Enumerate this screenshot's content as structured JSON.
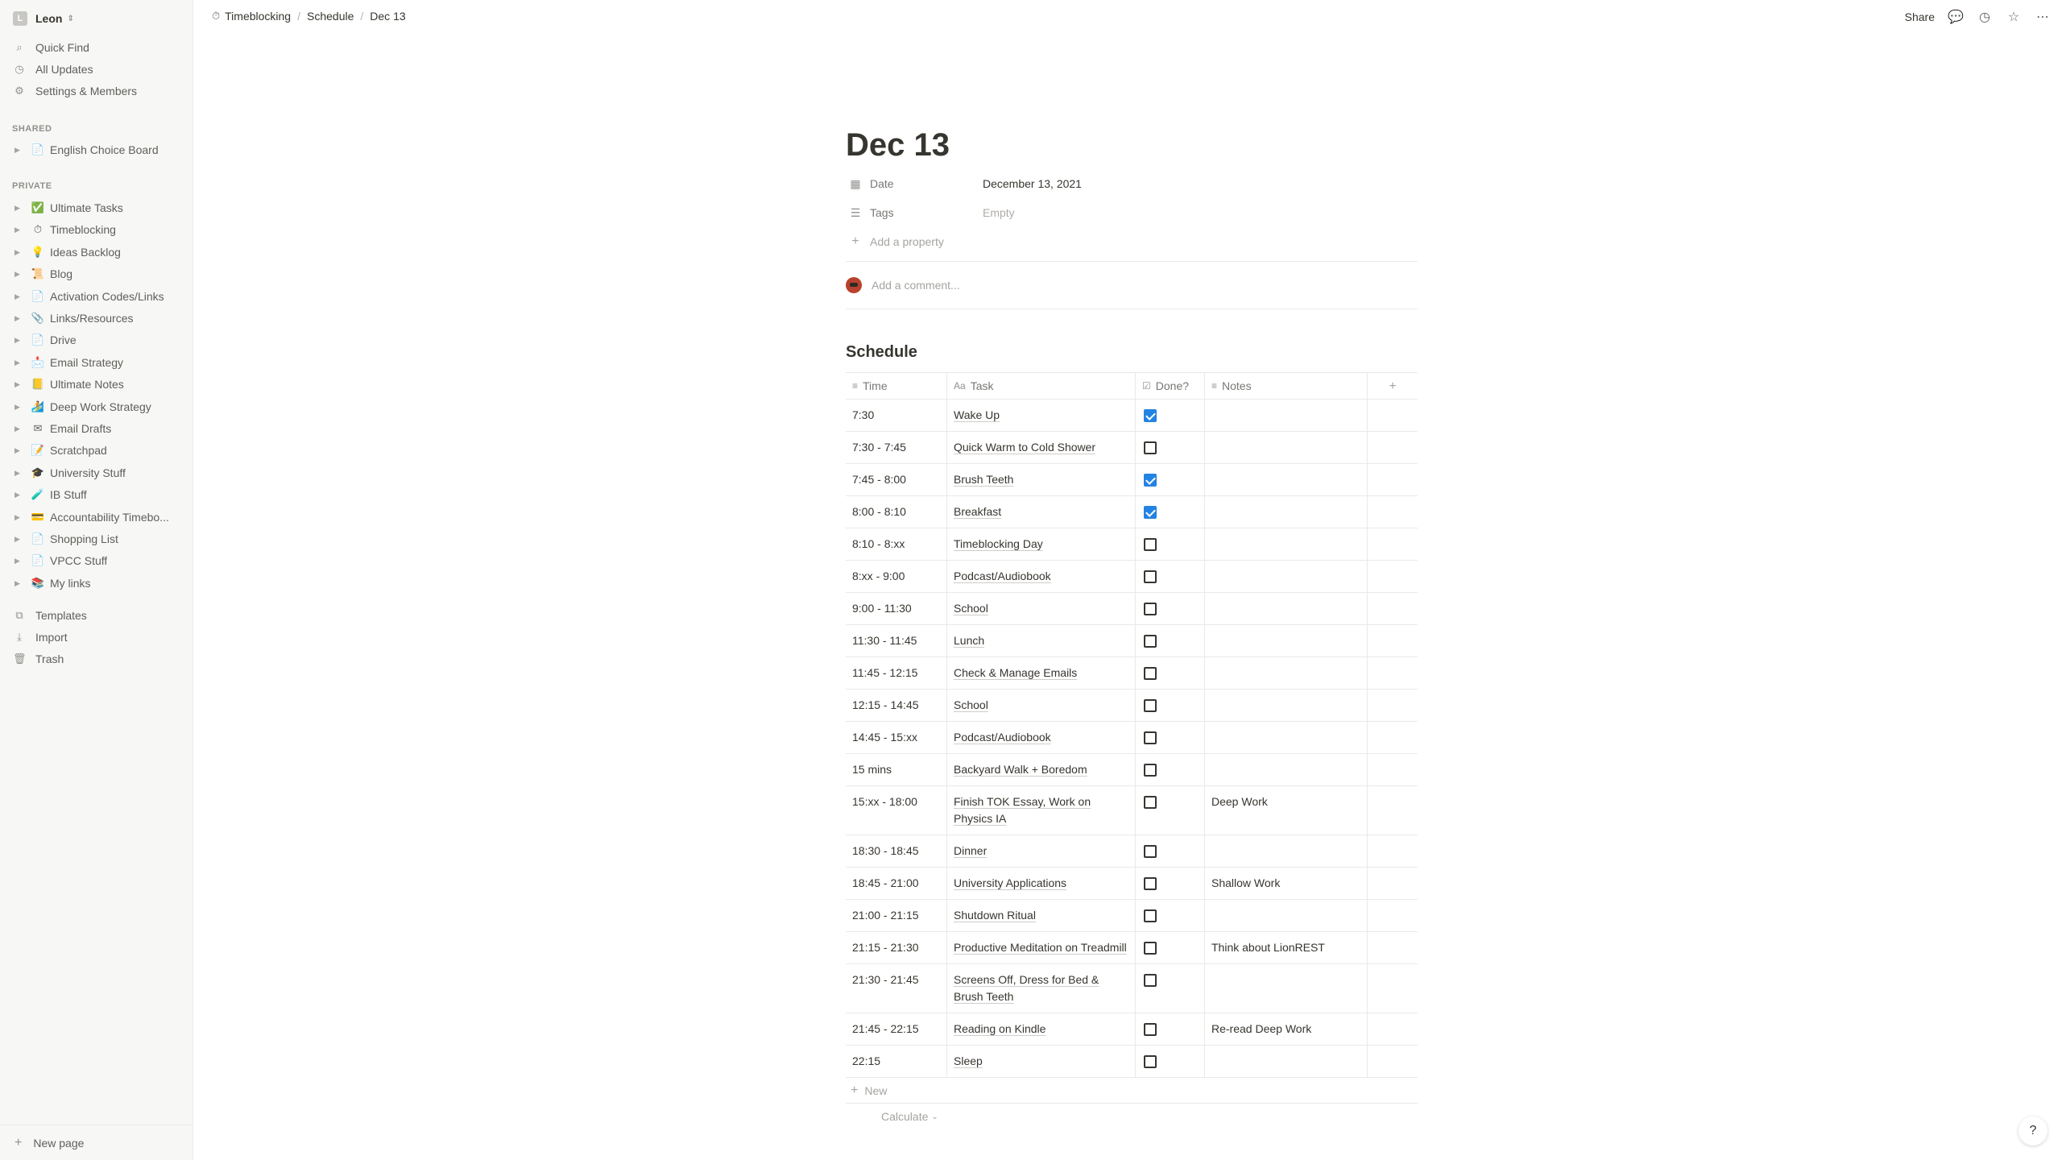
{
  "colors": {
    "sidebar_bg": "#f7f7f5",
    "accent": "#2383e2",
    "text": "#37352f",
    "muted": "#91908c"
  },
  "sidebar": {
    "workspace": {
      "initial": "L",
      "name": "Leon"
    },
    "nav": [
      {
        "label": "Quick Find",
        "icon": "search-icon"
      },
      {
        "label": "All Updates",
        "icon": "clock-icon"
      },
      {
        "label": "Settings & Members",
        "icon": "gear-icon"
      }
    ],
    "shared_label": "SHARED",
    "shared": [
      {
        "label": "English Choice Board",
        "emoji": "📄"
      }
    ],
    "private_label": "PRIVATE",
    "private": [
      {
        "label": "Ultimate Tasks",
        "emoji": "✅"
      },
      {
        "label": "Timeblocking",
        "emoji": "⏱"
      },
      {
        "label": "Ideas Backlog",
        "emoji": "💡"
      },
      {
        "label": "Blog",
        "emoji": "📜"
      },
      {
        "label": "Activation Codes/Links",
        "emoji": "📄"
      },
      {
        "label": "Links/Resources",
        "emoji": "📎"
      },
      {
        "label": "Drive",
        "emoji": "📄"
      },
      {
        "label": "Email Strategy",
        "emoji": "📩"
      },
      {
        "label": "Ultimate Notes",
        "emoji": "📒"
      },
      {
        "label": "Deep Work Strategy",
        "emoji": "🏄"
      },
      {
        "label": "Email Drafts",
        "emoji": "✉"
      },
      {
        "label": "Scratchpad",
        "emoji": "📝"
      },
      {
        "label": "University Stuff",
        "emoji": "🎓"
      },
      {
        "label": "IB Stuff",
        "emoji": "🧪"
      },
      {
        "label": "Accountability Timebo...",
        "emoji": "💳"
      },
      {
        "label": "Shopping List",
        "emoji": "📄"
      },
      {
        "label": "VPCC Stuff",
        "emoji": "📄"
      },
      {
        "label": "My links",
        "emoji": "📚"
      }
    ],
    "bottom": [
      {
        "label": "Templates",
        "icon": "templates-icon"
      },
      {
        "label": "Import",
        "icon": "import-icon"
      },
      {
        "label": "Trash",
        "icon": "trash-icon"
      }
    ],
    "new_page": "New page"
  },
  "topbar": {
    "breadcrumbs": [
      "Timeblocking",
      "Schedule",
      "Dec 13"
    ],
    "share": "Share"
  },
  "page": {
    "title": "Dec 13",
    "properties": [
      {
        "name": "Date",
        "value": "December 13, 2021",
        "icon": "calendar-icon"
      },
      {
        "name": "Tags",
        "value": "Empty",
        "icon": "list-icon"
      }
    ],
    "add_property": "Add a property",
    "comment_placeholder": "Add a comment...",
    "schedule_title": "Schedule",
    "table": {
      "columns": [
        "Time",
        "Task",
        "Done?",
        "Notes"
      ],
      "rows": [
        {
          "time": "7:30",
          "task": "Wake Up",
          "done": true,
          "notes": ""
        },
        {
          "time": "7:30 - 7:45",
          "task": "Quick Warm to Cold Shower",
          "done": false,
          "notes": ""
        },
        {
          "time": "7:45 - 8:00",
          "task": "Brush Teeth",
          "done": true,
          "notes": ""
        },
        {
          "time": "8:00 - 8:10",
          "task": "Breakfast",
          "done": true,
          "notes": ""
        },
        {
          "time": "8:10 - 8:xx",
          "task": "Timeblocking Day",
          "done": false,
          "notes": ""
        },
        {
          "time": "8:xx - 9:00",
          "task": "Podcast/Audiobook",
          "done": false,
          "notes": ""
        },
        {
          "time": "9:00 - 11:30",
          "task": "School",
          "done": false,
          "notes": ""
        },
        {
          "time": "11:30 - 11:45",
          "task": "Lunch",
          "done": false,
          "notes": ""
        },
        {
          "time": "11:45 - 12:15",
          "task": "Check & Manage Emails",
          "done": false,
          "notes": ""
        },
        {
          "time": "12:15 - 14:45",
          "task": "School",
          "done": false,
          "notes": ""
        },
        {
          "time": "14:45 - 15:xx",
          "task": "Podcast/Audiobook",
          "done": false,
          "notes": ""
        },
        {
          "time": "15 mins",
          "task": "Backyard Walk + Boredom",
          "done": false,
          "notes": ""
        },
        {
          "time": "15:xx - 18:00",
          "task": "Finish TOK Essay, Work on Physics IA",
          "done": false,
          "notes": "Deep Work"
        },
        {
          "time": "18:30 - 18:45",
          "task": "Dinner",
          "done": false,
          "notes": ""
        },
        {
          "time": "18:45 - 21:00",
          "task": "University Applications",
          "done": false,
          "notes": "Shallow Work"
        },
        {
          "time": "21:00 - 21:15",
          "task": "Shutdown Ritual",
          "done": false,
          "notes": ""
        },
        {
          "time": "21:15 - 21:30",
          "task": "Productive Meditation on Treadmill",
          "done": false,
          "notes": "Think about LionREST"
        },
        {
          "time": "21:30 - 21:45",
          "task": "Screens Off, Dress for Bed & Brush Teeth",
          "done": false,
          "notes": ""
        },
        {
          "time": "21:45 - 22:15",
          "task": "Reading on Kindle",
          "done": false,
          "notes": "Re-read Deep Work"
        },
        {
          "time": "22:15",
          "task": "Sleep",
          "done": false,
          "notes": ""
        }
      ],
      "new_label": "New",
      "calculate_label": "Calculate"
    }
  },
  "help": "?"
}
